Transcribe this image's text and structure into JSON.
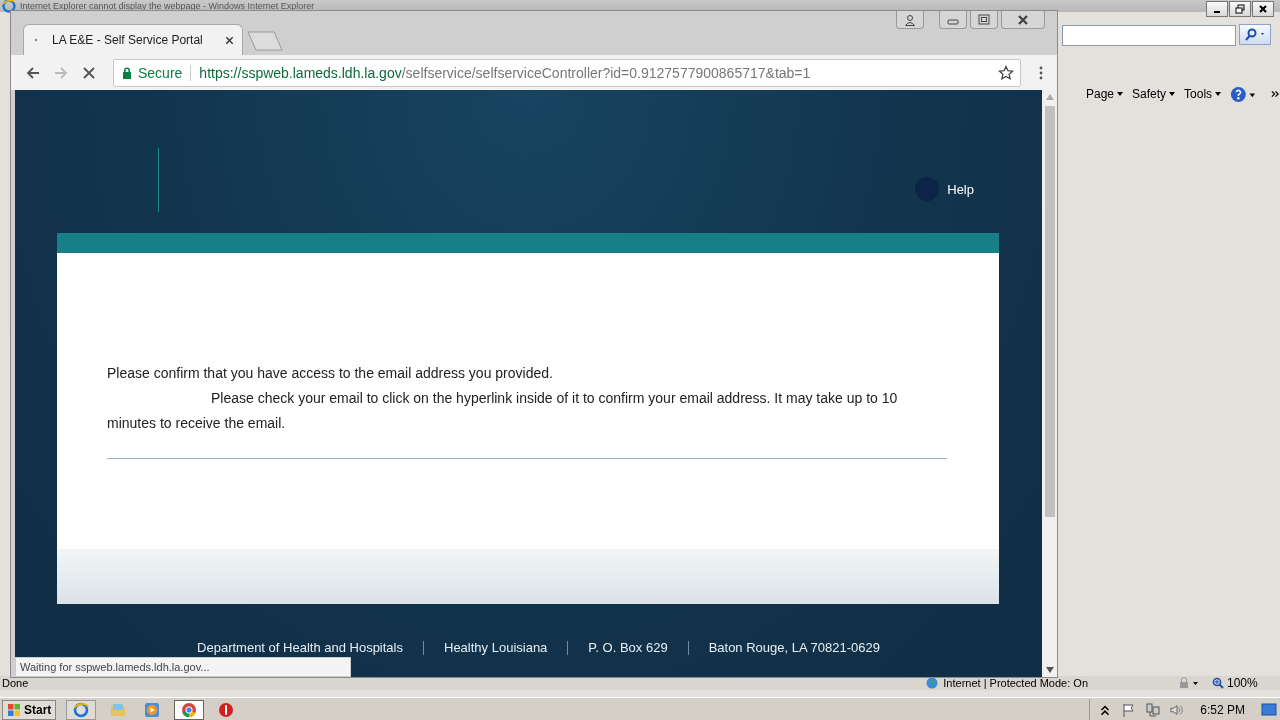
{
  "ie_window": {
    "title": "Internet Explorer cannot display the webpage - Windows Internet Explorer",
    "command_bar": [
      "Page",
      "Safety",
      "Tools"
    ],
    "status_bar": {
      "text": "Done",
      "zone": "Internet | Protected Mode: On",
      "zoom": "100%"
    }
  },
  "browser": {
    "tabs": [
      {
        "label": "LA E&E - Self Service Portal",
        "selected": true
      }
    ],
    "loading": true,
    "address": {
      "secure_label": "Secure",
      "url_host": "https://sspweb.lameds.ldh.la.gov",
      "url_path": "/selfservice/selfserviceController?id=0.9127577900865717&tab=1"
    },
    "status_bubble": "Waiting for sspweb.lameds.ldh.la.gov..."
  },
  "page": {
    "help": "Help",
    "message": "Please confirm that you have access to the email address you provided.",
    "instruction": "Please check your email to click on the hyperlink inside of it to confirm your email address. It may take up to 10 minutes to receive the email.",
    "footer": [
      "Department of Health and Hospitals",
      "Healthy Louisiana",
      "P. O. Box 629",
      "Baton Rouge, LA 70821-0629"
    ]
  },
  "taskbar": {
    "start": "Start",
    "clock": "6:52 PM"
  }
}
